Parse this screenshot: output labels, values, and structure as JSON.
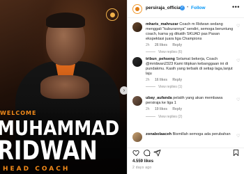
{
  "post": {
    "overlay": {
      "welcome": "WELCOME",
      "first_name": "MUHAMMAD",
      "last_name": "RIDWAN",
      "role": "HEAD COACH"
    }
  },
  "header": {
    "username": "persiraja_official",
    "follow_label": "Follow",
    "more_label": "•••",
    "verified_mark": "✓",
    "separator": "•"
  },
  "comments": [
    {
      "username": "mharis_mahruzar",
      "text": "Coach m Ridwan sedang menggali \"kuburannya\" sendiri, semoga beruntung coach, karna yg dikatih SKUAD pas Pasan ekspektasi juara liga Champions",
      "time": "2h",
      "likes": "26 likes",
      "reply": "Reply",
      "view_replies": "View replies (6)"
    },
    {
      "username": "tribun_pehseng",
      "text": "Selamat bekerja, Coach @mridwan2323 Kami titipkan kebanggaan ini di pundakmu. Kasih yang terbaik di setiap laga,lanjut laju",
      "time": "2h",
      "likes": "16 likes",
      "reply": "Reply",
      "view_replies": "View replies (1)"
    },
    {
      "username": "ubay_aufanda",
      "text": "pelatih yang akan membawa persiraja ke liga 1",
      "time": "2h",
      "likes": "19 likes",
      "reply": "Reply",
      "view_replies": "View replies (2)"
    },
    {
      "username": "zonabolaaceh",
      "text": "Bismillah semoga ada perubahan",
      "time": "",
      "likes": "",
      "reply": "",
      "view_replies": ""
    }
  ],
  "footer": {
    "likes_count": "4.559 likes",
    "date": "2 days ago"
  },
  "colors": {
    "accent_orange": "#f28a1a",
    "follow_blue": "#0095f6",
    "verified_blue": "#3897f0",
    "muted_text": "#8e8e8e"
  },
  "icons": [
    "heart-icon",
    "comment-icon",
    "share-icon",
    "bookmark-icon",
    "verified-badge-icon",
    "more-options-icon",
    "next-arrow-icon",
    "club-crest-icon"
  ]
}
